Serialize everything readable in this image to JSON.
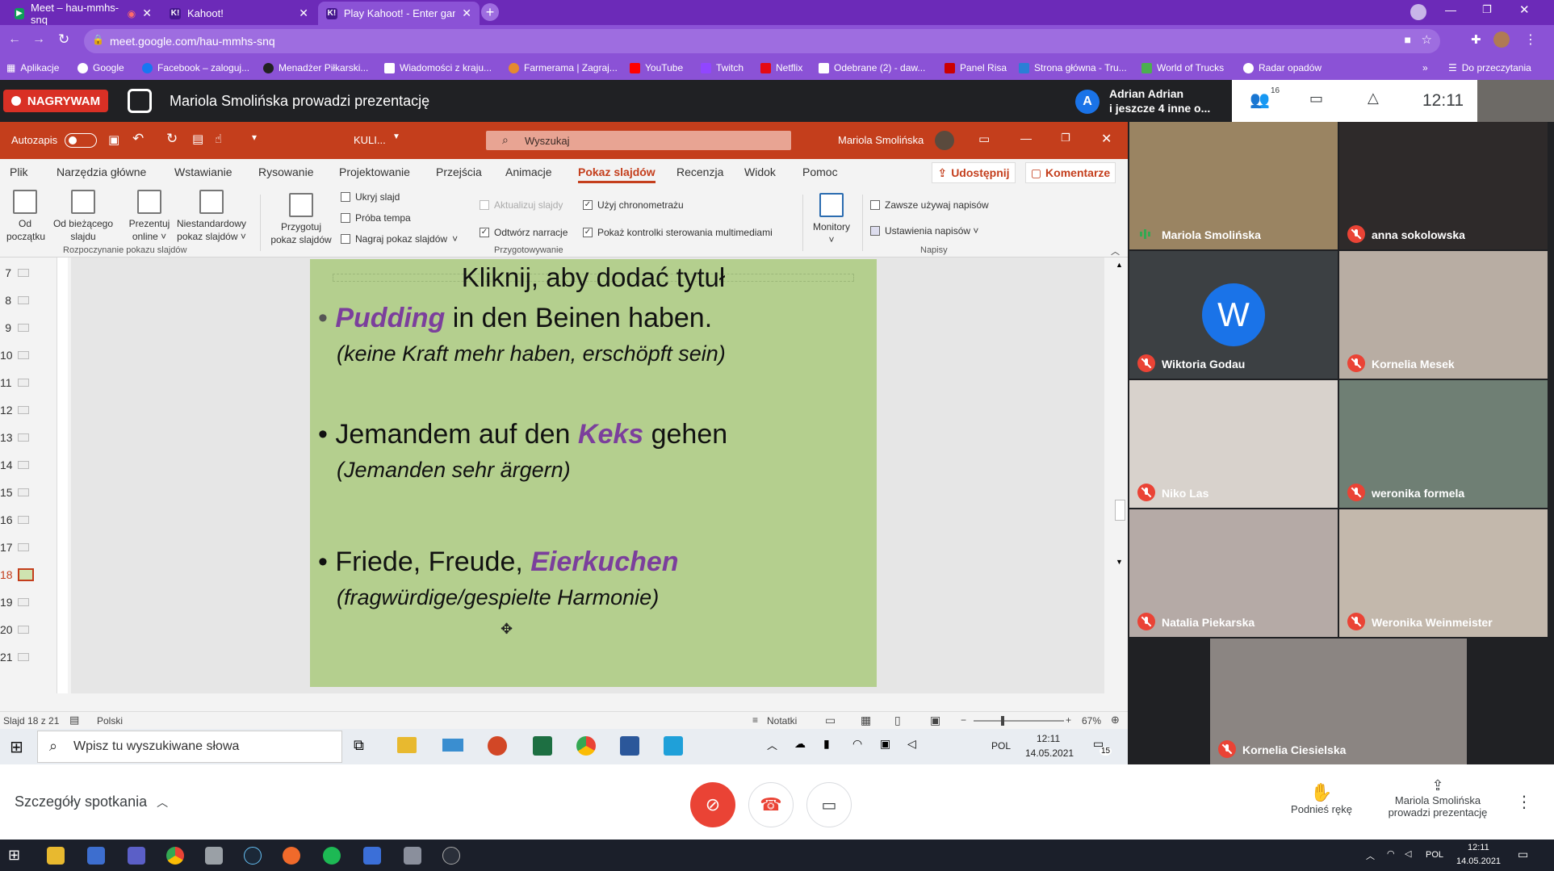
{
  "browser": {
    "tabs": [
      {
        "label": "Meet – hau-mmhs-snq",
        "active": false
      },
      {
        "label": "Kahoot!",
        "active": false
      },
      {
        "label": "Play Kahoot! - Enter game PIN h",
        "active": true
      }
    ],
    "url": "meet.google.com/hau-mmhs-snq",
    "bookmarks": [
      "Aplikacje",
      "Google",
      "Facebook – zaloguj...",
      "Menadżer Piłkarski...",
      "Wiadomości z kraju...",
      "Farmerama | Zagraj...",
      "YouTube",
      "Twitch",
      "Netflix",
      "Odebrane (2) - daw...",
      "Panel Risa",
      "Strona główna - Tru...",
      "World of Trucks",
      "Radar opadów"
    ],
    "bookmarks_overflow": "»",
    "reading_list": "Do przeczytania"
  },
  "meet_top": {
    "recording": "NAGRYWAM",
    "presenting": "Mariola Smolińska prowadzi prezentację",
    "viewer_avatar_letter": "A",
    "viewer_name": "Adrian Adrian",
    "viewer_others": "i jeszcze 4 inne o...",
    "people_count": "16",
    "time": "12:11"
  },
  "ppt": {
    "autosave_label": "Autozapis",
    "file_name": "KULI...",
    "search_placeholder": "Wyszukaj",
    "user_name": "Mariola Smolińska",
    "menu": [
      "Plik",
      "Narzędzia główne",
      "Wstawianie",
      "Rysowanie",
      "Projektowanie",
      "Przejścia",
      "Animacje",
      "Pokaz slajdów",
      "Recenzja",
      "Widok",
      "Pomoc"
    ],
    "share": "Udostępnij",
    "comments": "Komentarze",
    "ribbon": {
      "from_start_1": "Od",
      "from_start_2": "początku",
      "from_current_1": "Od bieżącego",
      "from_current_2": "slajdu",
      "present_online_1": "Prezentuj",
      "present_online_2": "online ˅",
      "custom_show_1": "Niestandardowy",
      "custom_show_2": "pokaz slajdów ˅",
      "group1": "Rozpoczynanie pokazu slajdów",
      "prepare_1": "Przygotuj",
      "prepare_2": "pokaz slajdów",
      "hide_slide": "Ukryj slajd",
      "rehearse": "Próba tempa",
      "record": "Nagraj pokaz slajdów",
      "update_slides": "Aktualizuj slajdy",
      "use_timings": "Użyj chronometrażu",
      "play_narrations": "Odtwórz narracje",
      "show_media_controls": "Pokaż kontrolki sterowania multimediami",
      "group2": "Przygotowywanie",
      "monitors": "Monitory",
      "always_captions": "Zawsze używaj napisów",
      "caption_settings": "Ustawienia napisów ˅",
      "group3": "Napisy"
    },
    "thumbnails": [
      "7",
      "8",
      "9",
      "10",
      "11",
      "12",
      "13",
      "14",
      "15",
      "16",
      "17",
      "18",
      "19",
      "20",
      "21"
    ],
    "selected_slide": "18",
    "slide": {
      "title": "Kliknij, aby dodać tytuł",
      "b1_kw": "Pudding",
      "b1_rest": " in den Beinen haben.",
      "b1_sub": "(keine Kraft mehr haben, erschöpft sein)",
      "b2_pre": "Jemandem auf den ",
      "b2_kw": "Keks",
      "b2_post": " gehen",
      "b2_sub": "(Jemanden sehr ärgern)",
      "b3_pre": "Friede, Freude, ",
      "b3_kw": "Eierkuchen",
      "b3_sub": "(fragwürdige/gespielte Harmonie)",
      "bullet": "•"
    },
    "status": {
      "slide_of": "Slajd 18 z 21",
      "language": "Polski",
      "notes": "Notatki",
      "zoom": "67%"
    }
  },
  "inner_taskbar": {
    "search_placeholder": "Wpisz tu wyszukiwane słowa",
    "lang": "POL",
    "time": "12:11",
    "date": "14.05.2021",
    "notif": "15"
  },
  "participants": [
    {
      "name": "Mariola Smolińska",
      "muted": false
    },
    {
      "name": "anna sokolowska",
      "muted": true
    },
    {
      "name": "Wiktoria Godau",
      "muted": true,
      "avatar": "W"
    },
    {
      "name": "Kornelia Mesek",
      "muted": true
    },
    {
      "name": "Niko Las",
      "muted": true
    },
    {
      "name": "weronika formela",
      "muted": true
    },
    {
      "name": "Natalia Piekarska",
      "muted": true
    },
    {
      "name": "Weronika Weinmeister",
      "muted": true
    },
    {
      "name": "Kornelia Ciesielska",
      "muted": true
    }
  ],
  "meet_bottom": {
    "details": "Szczegóły spotkania",
    "raise_hand": "Podnieś rękę",
    "presenting_1": "Mariola Smolińska",
    "presenting_2": "prowadzi prezentację"
  },
  "win_taskbar": {
    "lang": "POL",
    "time": "12:11",
    "date": "14.05.2021"
  },
  "colors": {
    "tab_strip": "#6c2ab8",
    "ppt_accent": "#c43e1c",
    "slide_bg": "#b4cf8e",
    "keyword": "#7b3f9c",
    "mute_red": "#ea4335"
  }
}
